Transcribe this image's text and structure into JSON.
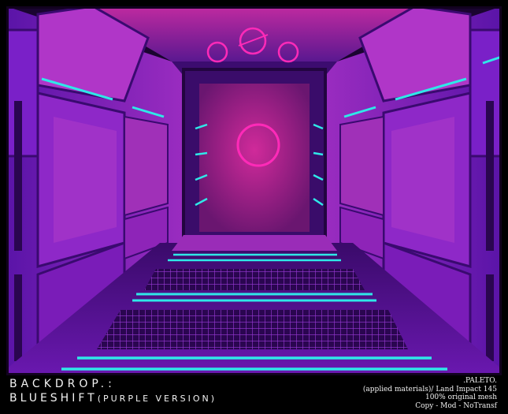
{
  "caption": {
    "line1": "BACKDROP.:",
    "line2_main": "BLUESHIFT",
    "line2_sub": "(PURPLE VERSION)"
  },
  "credits": {
    "brand": ".PALETO.",
    "materials": "(applied materials)/ Land Impact 145",
    "mesh": "100% original mesh",
    "perms": "Copy - Mod - NoTransf"
  },
  "colors": {
    "magenta": "#e0289a",
    "violet": "#7a1fd0",
    "cyan": "#2fe8e8",
    "frame": "#000000"
  }
}
